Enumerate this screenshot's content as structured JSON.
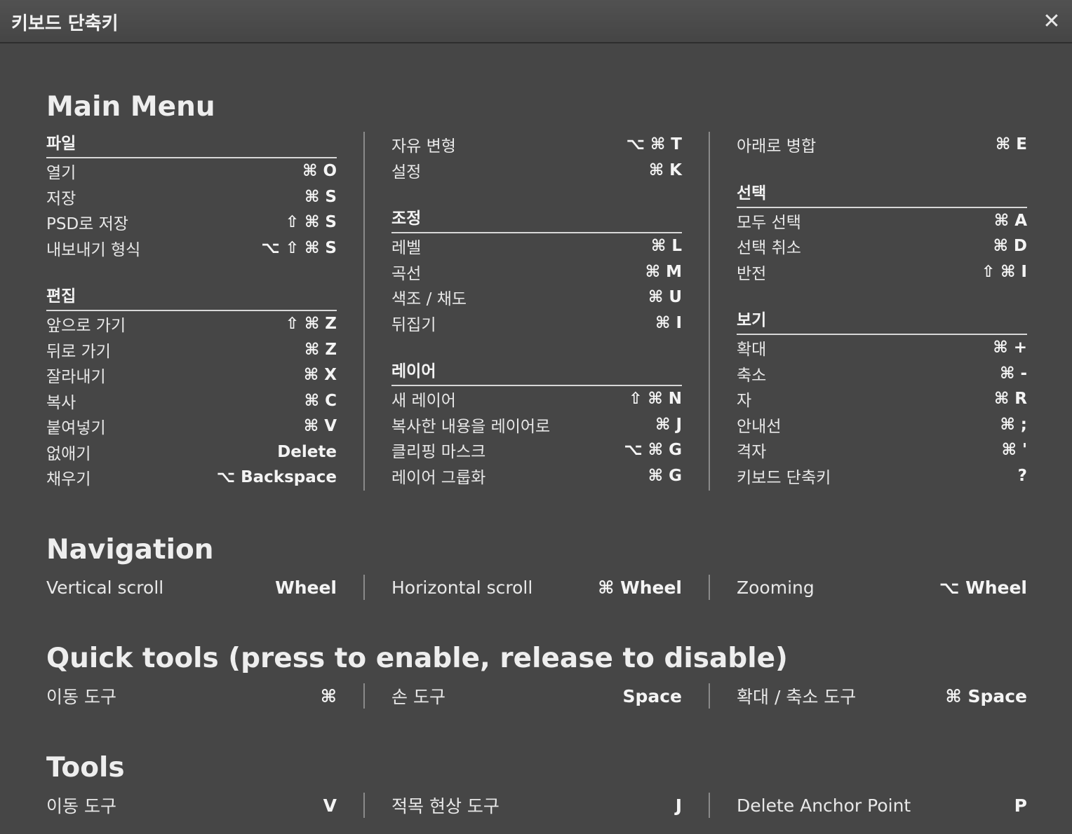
{
  "dialog": {
    "title": "키보드 단축키",
    "close_label": "✕"
  },
  "main_menu": {
    "title": "Main Menu",
    "columns": [
      [
        {
          "heading": "파일",
          "items": [
            {
              "label": "열기",
              "key": "⌘ O"
            },
            {
              "label": "저장",
              "key": "⌘ S"
            },
            {
              "label": "PSD로 저장",
              "key": "⇧ ⌘ S"
            },
            {
              "label": "내보내기 형식",
              "key": "⌥ ⇧ ⌘ S"
            }
          ]
        },
        {
          "heading": "편집",
          "items": [
            {
              "label": "앞으로 가기",
              "key": "⇧ ⌘ Z"
            },
            {
              "label": "뒤로 가기",
              "key": "⌘ Z"
            },
            {
              "label": "잘라내기",
              "key": "⌘ X"
            },
            {
              "label": "복사",
              "key": "⌘ C"
            },
            {
              "label": "붙여넣기",
              "key": "⌘ V"
            },
            {
              "label": "없애기",
              "key": "Delete"
            },
            {
              "label": "채우기",
              "key": "⌥ Backspace"
            }
          ]
        }
      ],
      [
        {
          "heading": "",
          "items": [
            {
              "label": "자유 변형",
              "key": "⌥ ⌘ T"
            },
            {
              "label": "설정",
              "key": "⌘ K"
            }
          ]
        },
        {
          "heading": "조정",
          "items": [
            {
              "label": "레벨",
              "key": "⌘ L"
            },
            {
              "label": "곡선",
              "key": "⌘ M"
            },
            {
              "label": "색조 / 채도",
              "key": "⌘ U"
            },
            {
              "label": "뒤집기",
              "key": "⌘ I"
            }
          ]
        },
        {
          "heading": "레이어",
          "items": [
            {
              "label": "새 레이어",
              "key": "⇧ ⌘ N"
            },
            {
              "label": "복사한 내용을 레이어로",
              "key": "⌘ J"
            },
            {
              "label": "클리핑 마스크",
              "key": "⌥ ⌘ G"
            },
            {
              "label": "레이어 그룹화",
              "key": "⌘ G"
            }
          ]
        }
      ],
      [
        {
          "heading": "",
          "items": [
            {
              "label": "아래로 병합",
              "key": "⌘ E"
            }
          ]
        },
        {
          "heading": "선택",
          "items": [
            {
              "label": "모두 선택",
              "key": "⌘ A"
            },
            {
              "label": "선택 취소",
              "key": "⌘ D"
            },
            {
              "label": "반전",
              "key": "⇧ ⌘ I"
            }
          ]
        },
        {
          "heading": "보기",
          "items": [
            {
              "label": "확대",
              "key": "⌘ +"
            },
            {
              "label": "축소",
              "key": "⌘ -"
            },
            {
              "label": "자",
              "key": "⌘ R"
            },
            {
              "label": "안내선",
              "key": "⌘ ;"
            },
            {
              "label": "격자",
              "key": "⌘ '"
            },
            {
              "label": "키보드 단축키",
              "key": "?"
            }
          ]
        }
      ]
    ]
  },
  "navigation": {
    "title": "Navigation",
    "items": [
      {
        "label": "Vertical scroll",
        "key": "Wheel"
      },
      {
        "label": "Horizontal scroll",
        "key": "⌘ Wheel"
      },
      {
        "label": "Zooming",
        "key": "⌥ Wheel"
      }
    ]
  },
  "quick_tools": {
    "title": "Quick tools (press to enable, release to disable)",
    "items": [
      {
        "label": "이동 도구",
        "key": "⌘"
      },
      {
        "label": "손 도구",
        "key": "Space"
      },
      {
        "label": "확대 / 축소 도구",
        "key": "⌘ Space"
      }
    ]
  },
  "tools": {
    "title": "Tools",
    "items": [
      {
        "label": "이동 도구",
        "key": "V"
      },
      {
        "label": "적목 현상 도구",
        "key": "J"
      },
      {
        "label": "Delete Anchor Point",
        "key": "P"
      }
    ]
  }
}
